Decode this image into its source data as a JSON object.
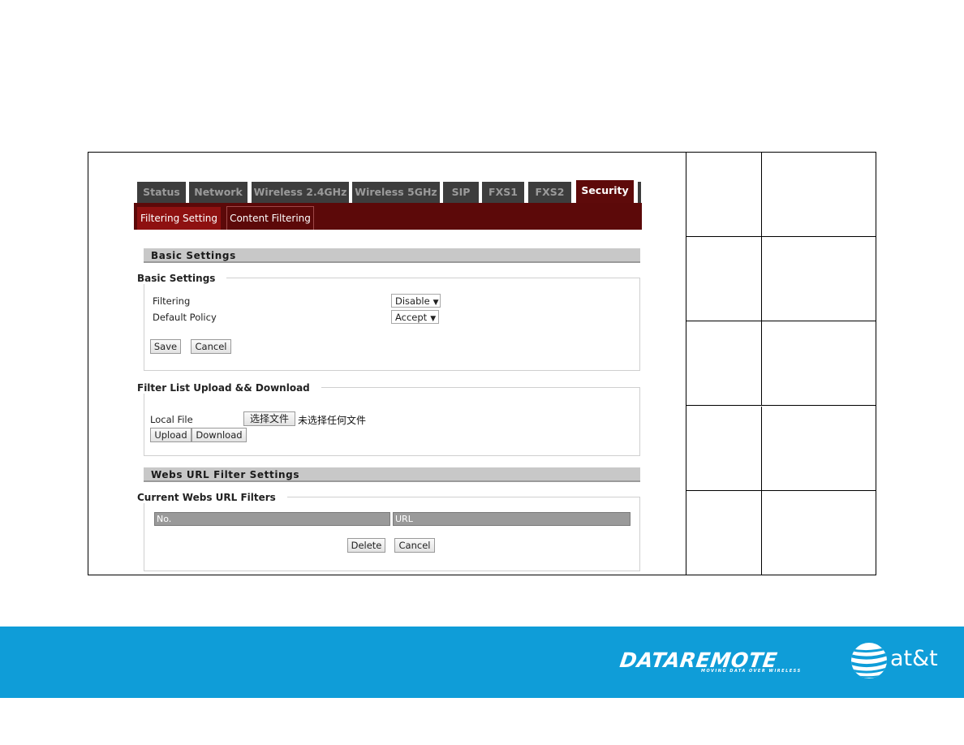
{
  "router_ui": {
    "main_tabs": [
      {
        "label": "Status",
        "active": false
      },
      {
        "label": "Network",
        "active": false
      },
      {
        "label": "Wireless 2.4GHz",
        "active": false
      },
      {
        "label": "Wireless 5GHz",
        "active": false
      },
      {
        "label": "SIP",
        "active": false
      },
      {
        "label": "FXS1",
        "active": false
      },
      {
        "label": "FXS2",
        "active": false
      },
      {
        "label": "Security",
        "active": true
      }
    ],
    "sub_tabs": [
      {
        "label": "Filtering Setting",
        "active": true
      },
      {
        "label": "Content Filtering",
        "active": false
      }
    ],
    "basic_settings": {
      "section_title": "Basic Settings",
      "legend": "Basic Settings",
      "filtering_label": "Filtering",
      "filtering_value": "Disable",
      "default_policy_label": "Default Policy",
      "default_policy_value": "Accept",
      "save_label": "Save",
      "cancel_label": "Cancel"
    },
    "filter_list": {
      "legend": "Filter List Upload && Download",
      "local_file_label": "Local File",
      "choose_file_label": "选择文件",
      "no_file_text": "未选择任何文件",
      "upload_label": "Upload",
      "download_label": "Download"
    },
    "url_filter": {
      "section_title": "Webs URL Filter Settings",
      "legend": "Current Webs URL Filters",
      "columns": [
        "No.",
        "URL"
      ],
      "rows": [],
      "delete_label": "Delete",
      "cancel_label": "Cancel"
    }
  },
  "side_table": {
    "rows": [
      [
        "",
        ""
      ],
      [
        "",
        ""
      ],
      [
        "",
        ""
      ],
      [
        "",
        ""
      ],
      [
        "",
        ""
      ]
    ]
  },
  "footer": {
    "brand": "DATAREMOTE",
    "tagline": "MOVING DATA OVER WIRELESS",
    "partner": "at&t",
    "background_color": "#0f9dd8"
  },
  "colors": {
    "tab_dark": "#3d3d3d",
    "tab_active": "#5e0a0a",
    "subtab_active": "#8e1111",
    "section_header": "#c8c8c8",
    "table_header": "#9a9a9a"
  }
}
